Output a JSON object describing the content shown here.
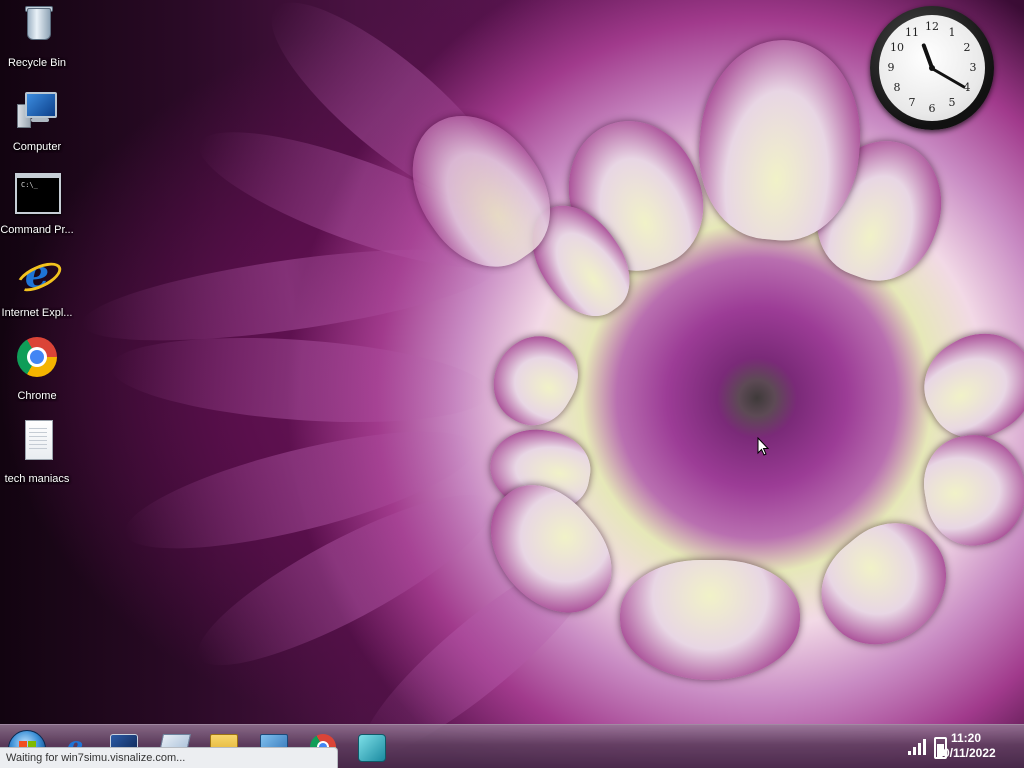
{
  "desktop": {
    "icons": [
      {
        "label": "Recycle Bin",
        "icon": "recycle-bin-icon"
      },
      {
        "label": "Computer",
        "icon": "computer-icon"
      },
      {
        "label": "Command Pr...",
        "icon": "command-prompt-icon"
      },
      {
        "label": "Internet Expl...",
        "icon": "internet-explorer-icon"
      },
      {
        "label": "Chrome",
        "icon": "chrome-icon"
      },
      {
        "label": "tech maniacs",
        "icon": "text-document-icon"
      }
    ],
    "cmd_icon_text": "C:\\_"
  },
  "clock_gadget": {
    "numbers": [
      "12",
      "1",
      "2",
      "3",
      "4",
      "5",
      "6",
      "7",
      "8",
      "9",
      "10",
      "11"
    ],
    "time": "11:20"
  },
  "taskbar": {
    "pinned": [
      {
        "name": "start-button",
        "icon": "windows-orb-icon"
      },
      {
        "name": "internet-explorer",
        "icon": "internet-explorer-icon"
      },
      {
        "name": "media-center",
        "icon": "media-center-icon"
      },
      {
        "name": "documents",
        "icon": "document-icon"
      },
      {
        "name": "windows-explorer",
        "icon": "folder-icon"
      },
      {
        "name": "control-panel",
        "icon": "control-panel-icon"
      },
      {
        "name": "chrome",
        "icon": "chrome-icon"
      },
      {
        "name": "media-player",
        "icon": "media-player-icon"
      }
    ],
    "tray": {
      "time": "11:20",
      "date": "10/11/2022",
      "icons": [
        "signal-icon",
        "battery-icon"
      ],
      "battery_level": 0.85
    }
  },
  "status_bar": {
    "text": "Waiting for win7simu.visnalize.com..."
  },
  "colors": {
    "taskbar": "#5f3e5f",
    "label_text": "#ffffff",
    "status_bg": "#eceef1"
  }
}
